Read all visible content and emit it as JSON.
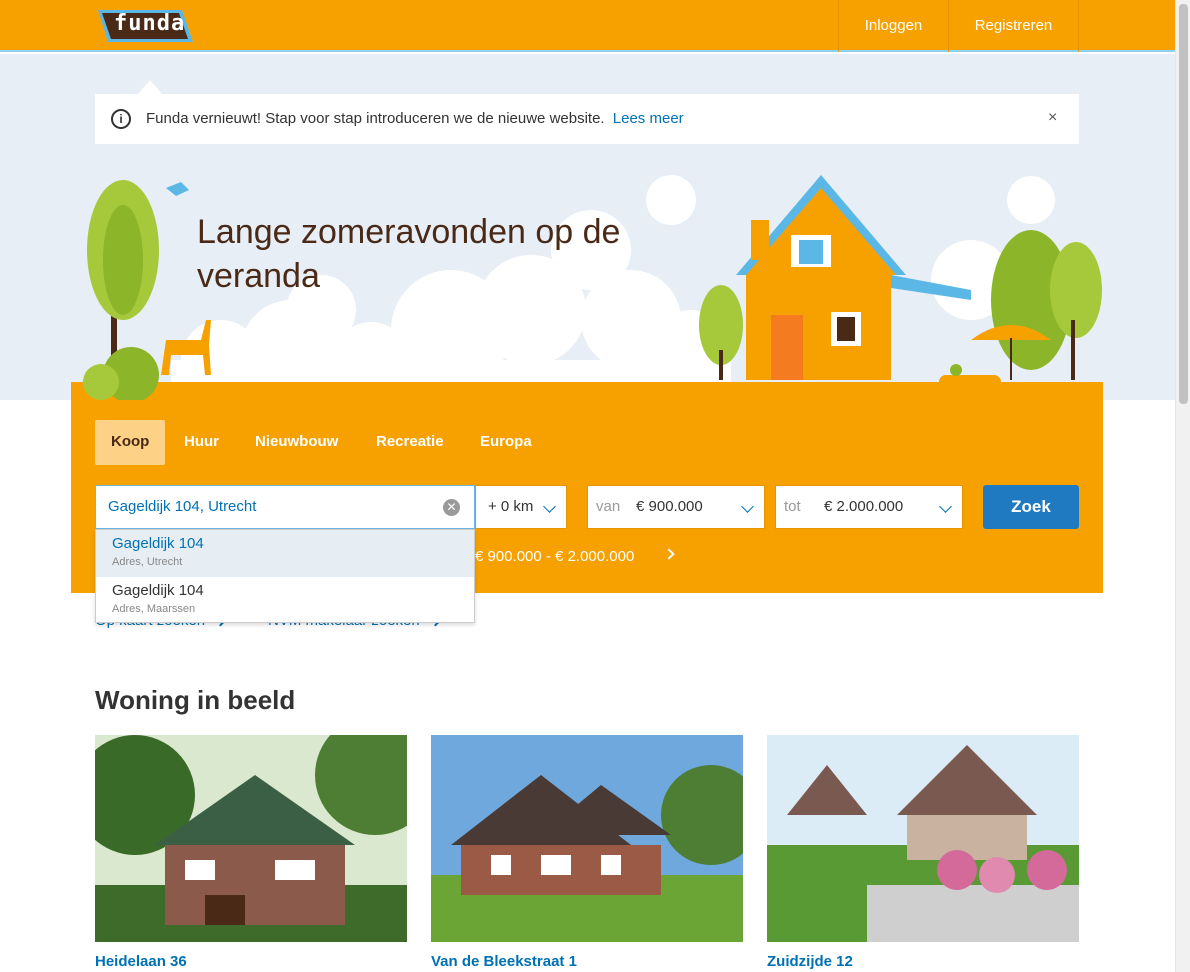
{
  "header": {
    "logo_text": "funda",
    "login_label": "Inloggen",
    "register_label": "Registreren"
  },
  "notice": {
    "text": "Funda vernieuwt! Stap voor stap introduceren we de nieuwe website.",
    "link_label": "Lees meer",
    "close_label": "×"
  },
  "hero": {
    "title": "Lange zomeravonden op de veranda"
  },
  "search": {
    "tabs": [
      {
        "label": "Koop",
        "active": true
      },
      {
        "label": "Huur",
        "active": false
      },
      {
        "label": "Nieuwbouw",
        "active": false
      },
      {
        "label": "Recreatie",
        "active": false
      },
      {
        "label": "Europa",
        "active": false
      }
    ],
    "location_value": "Gageldijk 104, Utrecht",
    "radius_value": "+ 0 km",
    "price_from_label": "van",
    "price_from_value": "€ 900.000",
    "price_to_label": "tot",
    "price_to_value": "€ 2.000.000",
    "submit_label": "Zoek",
    "summary_text": "€ 900.000 - € 2.000.000"
  },
  "autocomplete": [
    {
      "title": "Gageldijk 104",
      "subtitle": "Adres, Utrecht"
    },
    {
      "title": "Gageldijk 104",
      "subtitle": "Adres, Maarssen"
    }
  ],
  "links": {
    "map_search": "Op kaart zoeken",
    "nvm_search": "NVM makelaar zoeken"
  },
  "featured": {
    "title": "Woning in beeld",
    "cards": [
      {
        "title": "Heidelaan 36"
      },
      {
        "title": "Van de Bleekstraat 1"
      },
      {
        "title": "Zuidzijde 12"
      }
    ]
  },
  "colors": {
    "brand_orange": "#f7a100",
    "link_blue": "#0071b3",
    "button_blue": "#1f7ac2"
  }
}
